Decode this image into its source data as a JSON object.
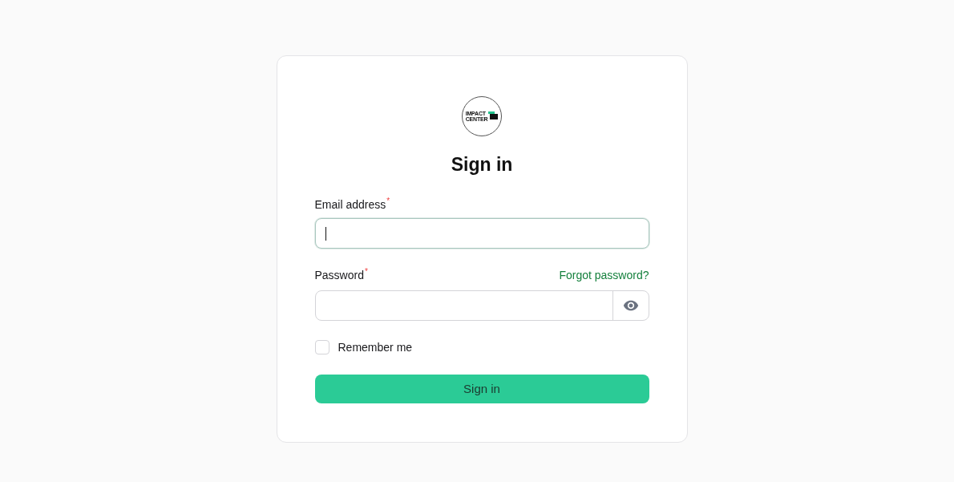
{
  "logo": {
    "lines": [
      "IMPACT",
      "CENTER"
    ]
  },
  "title": "Sign in",
  "fields": [
    {
      "kind": "email",
      "label": "Email address",
      "mark": "*",
      "focused": true
    },
    {
      "kind": "password",
      "label": "Password",
      "mark": "*",
      "focused": false,
      "link": "Forgot password?"
    }
  ],
  "remember": {
    "label": "Remember me",
    "checked": false
  },
  "submit": "Sign in"
}
